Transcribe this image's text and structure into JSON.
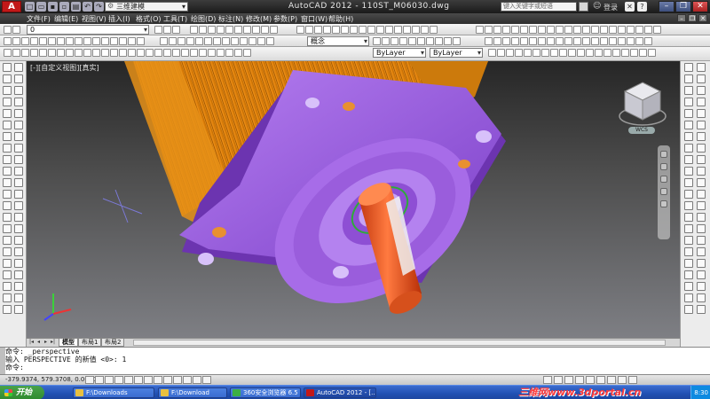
{
  "app": {
    "title": "AutoCAD 2012  -  110ST_M06030.dwg",
    "logo_text": "A",
    "workspace": "三维建模",
    "help_search_placeholder": "键入关键字或短语",
    "login_label": "登录"
  },
  "menu": [
    "文件(F)",
    "编辑(E)",
    "视图(V)",
    "插入(I)",
    "格式(O)",
    "工具(T)",
    "绘图(D)",
    "标注(N)",
    "修改(M)",
    "参数(P)",
    "窗口(W)",
    "帮助(H)"
  ],
  "toolbars": {
    "layer_value": "0",
    "visual_style_value": "概念",
    "color_value": "ByLayer",
    "linetype_value": "ByLayer"
  },
  "viewport": {
    "label": "[-][自定义视图][真实]",
    "viewcube_wcs": "WCS"
  },
  "layout_tabs": [
    "模型",
    "布局1",
    "布局2"
  ],
  "command_line": [
    "命令: _perspective",
    "输入 PERSPECTIVE 的新值 <0>: 1",
    "命令:"
  ],
  "status": {
    "coords": "-379.9374, 579.3708, 0.0000"
  },
  "taskbar": {
    "start_label": "开始",
    "tasks": [
      {
        "label": "F:\\Downloads",
        "color": "#e8c040"
      },
      {
        "label": "F:\\Download",
        "color": "#e8c040"
      },
      {
        "label": "360安全浏览器 6.5",
        "color": "#3cb043"
      },
      {
        "label": "AutoCAD 2012 - [...",
        "color": "#c21818"
      }
    ],
    "watermark": "三维网www.3dportal.cn",
    "clock": "8:30"
  },
  "colors": {
    "motor_flange": "#9b5be0",
    "motor_body": "#e8901c",
    "shaft": "#e8521a",
    "viewport_bg_top": "#262626",
    "viewport_bg_bottom": "#7e7f84"
  }
}
